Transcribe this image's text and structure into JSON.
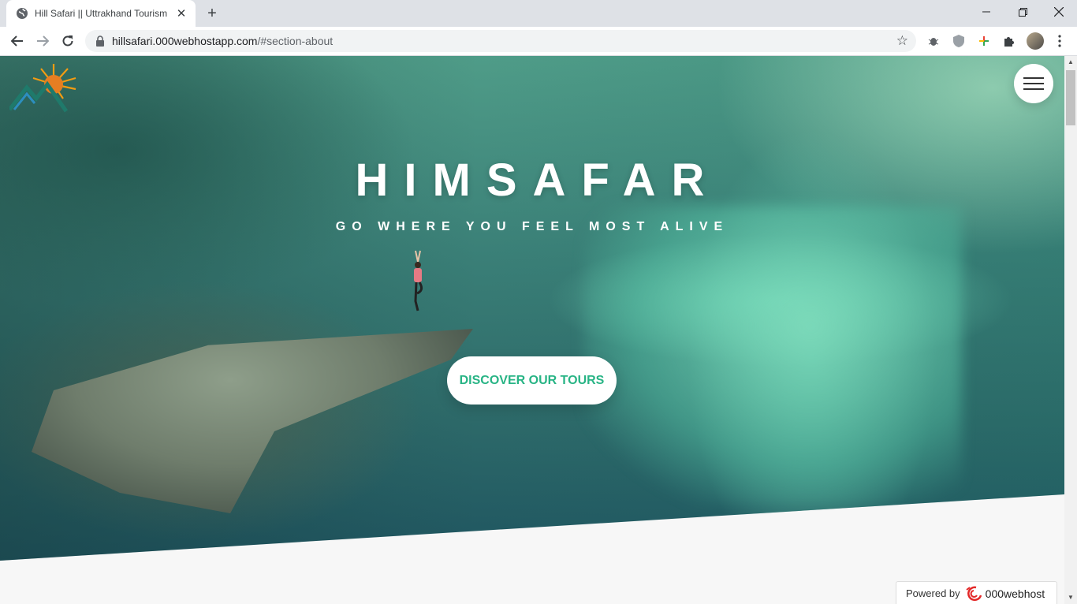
{
  "browser": {
    "tab_title": "Hill Safari || Uttrakhand Tourism",
    "url_host": "hillsafari.000webhostapp.com",
    "url_path": "/#section-about"
  },
  "hero": {
    "title": "HIMSAFAR",
    "subtitle": "GO WHERE YOU FEEL MOST ALIVE",
    "cta_label": "DISCOVER OUR TOURS"
  },
  "footer_badge": {
    "powered_label": "Powered by",
    "brand": "000webhost"
  },
  "colors": {
    "accent": "#28b485",
    "tabbar": "#dee1e6"
  },
  "icons": [
    "globe-icon",
    "close-icon",
    "plus-icon",
    "back-icon",
    "forward-icon",
    "reload-icon",
    "lock-icon",
    "star-icon",
    "menu-icon"
  ]
}
